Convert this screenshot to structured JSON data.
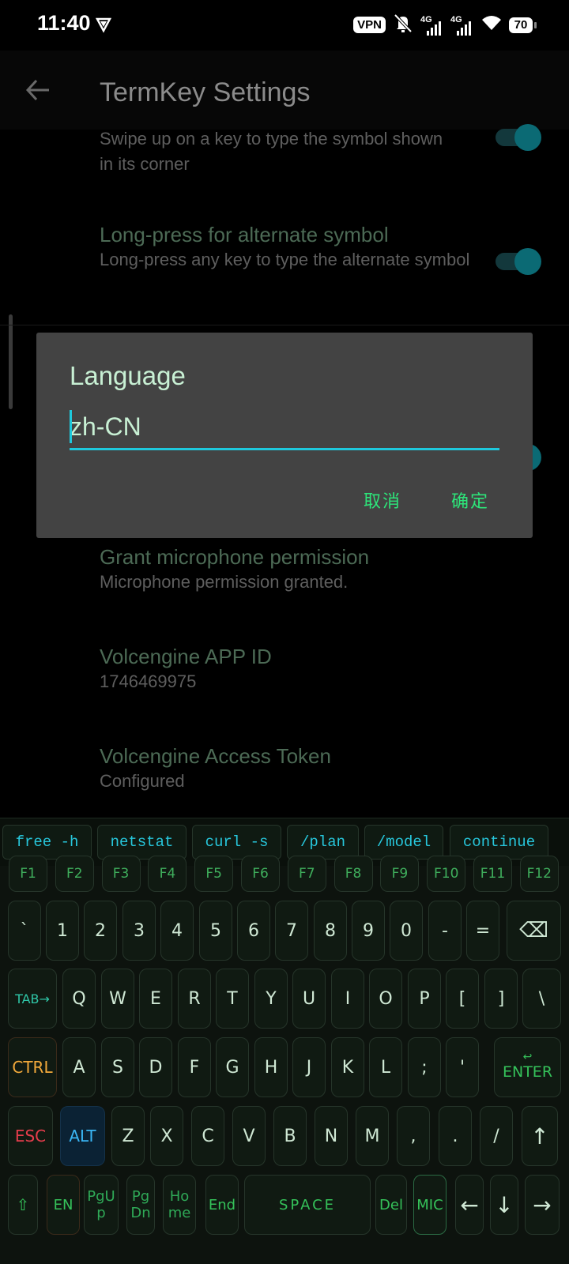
{
  "status_bar": {
    "time": "11:40",
    "vpn": "VPN",
    "net1": "4G",
    "net2": "4G",
    "battery": "70"
  },
  "app_bar": {
    "title": "TermKey Settings"
  },
  "settings": [
    {
      "summary": "Swipe up on a key to type the symbol shown in its corner",
      "toggle": true
    },
    {
      "title": "Long-press for alternate symbol",
      "summary": "Long-press any key to type the alternate symbol",
      "toggle": true
    },
    {
      "title": "Grant microphone permission",
      "summary": "Microphone permission granted."
    },
    {
      "title": "Volcengine APP ID",
      "summary": "1746469975"
    },
    {
      "title": "Volcengine Access Token",
      "summary": "Configured"
    }
  ],
  "dialog": {
    "title": "Language",
    "value": "zh-CN",
    "cancel": "取消",
    "ok": "确定"
  },
  "quick_keys": [
    "free -h",
    "netstat",
    "curl -s",
    "/plan",
    "/model",
    "continue"
  ],
  "f_keys": [
    "F1",
    "F2",
    "F3",
    "F4",
    "F5",
    "F6",
    "F7",
    "F8",
    "F9",
    "F10",
    "F11",
    "F12"
  ],
  "row_numbers": [
    "`",
    "1",
    "2",
    "3",
    "4",
    "5",
    "6",
    "7",
    "8",
    "9",
    "0",
    "-",
    "=",
    "⌫"
  ],
  "row_q": [
    "TAB→",
    "Q",
    "W",
    "E",
    "R",
    "T",
    "Y",
    "U",
    "I",
    "O",
    "P",
    "[",
    "]",
    "\\"
  ],
  "row_a": [
    "CTRL",
    "A",
    "S",
    "D",
    "F",
    "G",
    "H",
    "J",
    "K",
    "L",
    ";",
    "'"
  ],
  "enter": {
    "glyph": "↩",
    "label": "ENTER"
  },
  "row_z": [
    "ESC",
    "ALT",
    "Z",
    "X",
    "C",
    "V",
    "B",
    "N",
    "M",
    ",",
    ".",
    "/",
    "↑"
  ],
  "row_bottom": [
    "⇧",
    "EN",
    "PgUp",
    "PgDn",
    "Home",
    "End",
    "SPACE",
    "Del",
    "MIC",
    "←",
    "↓",
    "→"
  ]
}
